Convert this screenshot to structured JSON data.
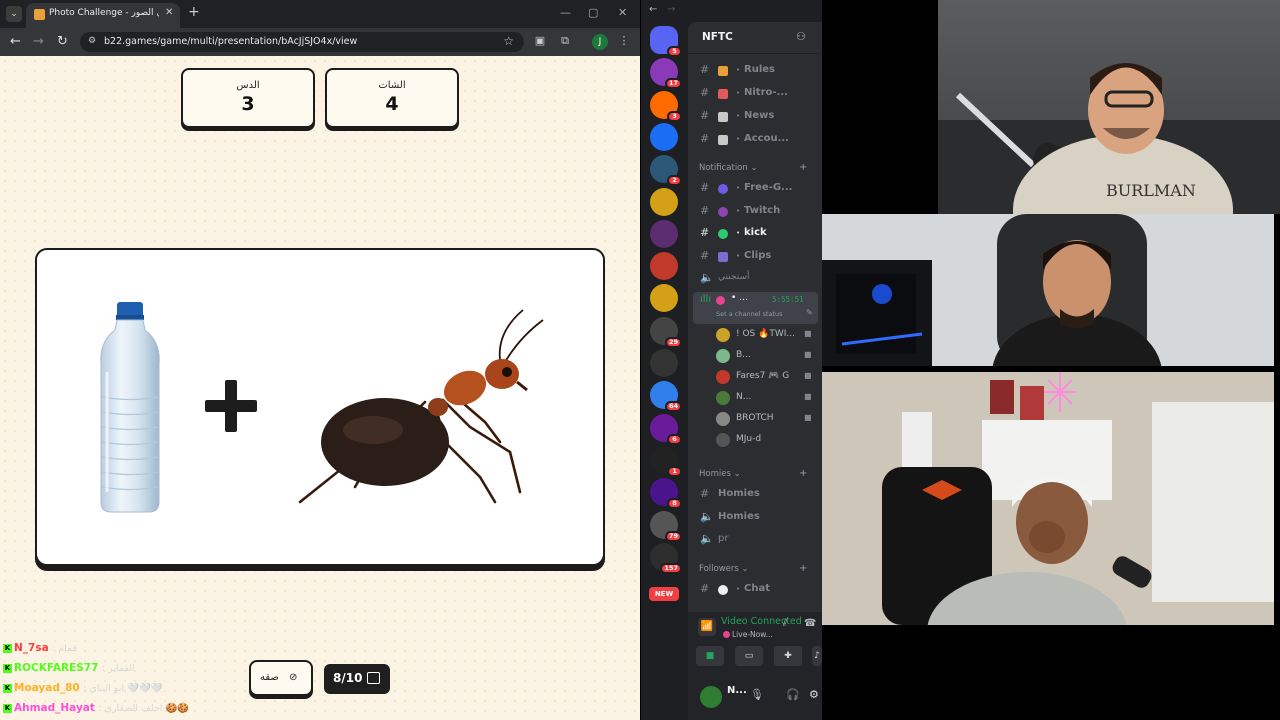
{
  "browser": {
    "tab_title": "Photo Challenge - تحدي الصور",
    "url": "b22.games/game/multi/presentation/bAcJjSJO4x/view",
    "profile_initial": "J"
  },
  "game": {
    "scores": [
      {
        "name": "الدس",
        "value": "3"
      },
      {
        "name": "الشات",
        "value": "4"
      }
    ],
    "skip_label": "صقه",
    "counter": "8/10"
  },
  "chat": [
    {
      "user": "N_7sa",
      "msg": ": قمام",
      "color": "#ff3b3b"
    },
    {
      "user": "ROCKFARES77",
      "msg": ": الفماير",
      "color": "#53fc18"
    },
    {
      "user": "Moayad_80",
      "msg": ": ابو اليناي 🤍🤍🤍",
      "color": "#ffb020"
    },
    {
      "user": "Ahmad_Hayat",
      "msg": ": احلف الصقاري 🍪🍪",
      "color": "#ff4fd8"
    }
  ],
  "discord": {
    "server_name": "NFTC",
    "guild_badges": [
      "5",
      "17",
      "3",
      "",
      "2",
      "",
      "",
      "",
      "",
      "29",
      "",
      "64",
      "6",
      "1",
      "8",
      "79",
      "157"
    ],
    "new_label": "NEW",
    "channels": [
      {
        "name": "Rules",
        "color": "#e8a13a"
      },
      {
        "name": "Nitro-...",
        "color": "#e05a5a"
      },
      {
        "name": "News",
        "color": "#c8c8c8"
      },
      {
        "name": "Accou...",
        "color": "#c8c8c8"
      }
    ],
    "category_notification": "Notification",
    "notif_channels": [
      {
        "name": "Free-G...",
        "color": "#6c5ce7",
        "white": false
      },
      {
        "name": "Twitch",
        "color": "#8e44ad",
        "white": false
      },
      {
        "name": "kick",
        "color": "#2ecc71",
        "white": true
      },
      {
        "name": "Clips",
        "color": "#7d6bd0",
        "white": false
      }
    ],
    "voice_arabic": "أستجنني",
    "voice_active_time": "5:55:51",
    "voice_status": "Set a channel status",
    "voice_users": [
      {
        "name": "! OS 🔥TWI...",
        "color": "#c9a227"
      },
      {
        "name": "B...",
        "color": "#7bb88a"
      },
      {
        "name": "Fares7 🎮 G",
        "color": "#c0392b"
      },
      {
        "name": "N...",
        "color": "#4a7a3a"
      },
      {
        "name": "BROTCH",
        "color": "#888"
      },
      {
        "name": "MJu-d",
        "color": "#555"
      }
    ],
    "category_homies": "Homies",
    "homies": [
      "Homies",
      "Homies",
      "pr"
    ],
    "category_followers": "Followers",
    "followers": [
      "Chat"
    ],
    "rtc_title": "Video Connected",
    "rtc_sub": "Live-Now...",
    "user_name": "N..."
  }
}
